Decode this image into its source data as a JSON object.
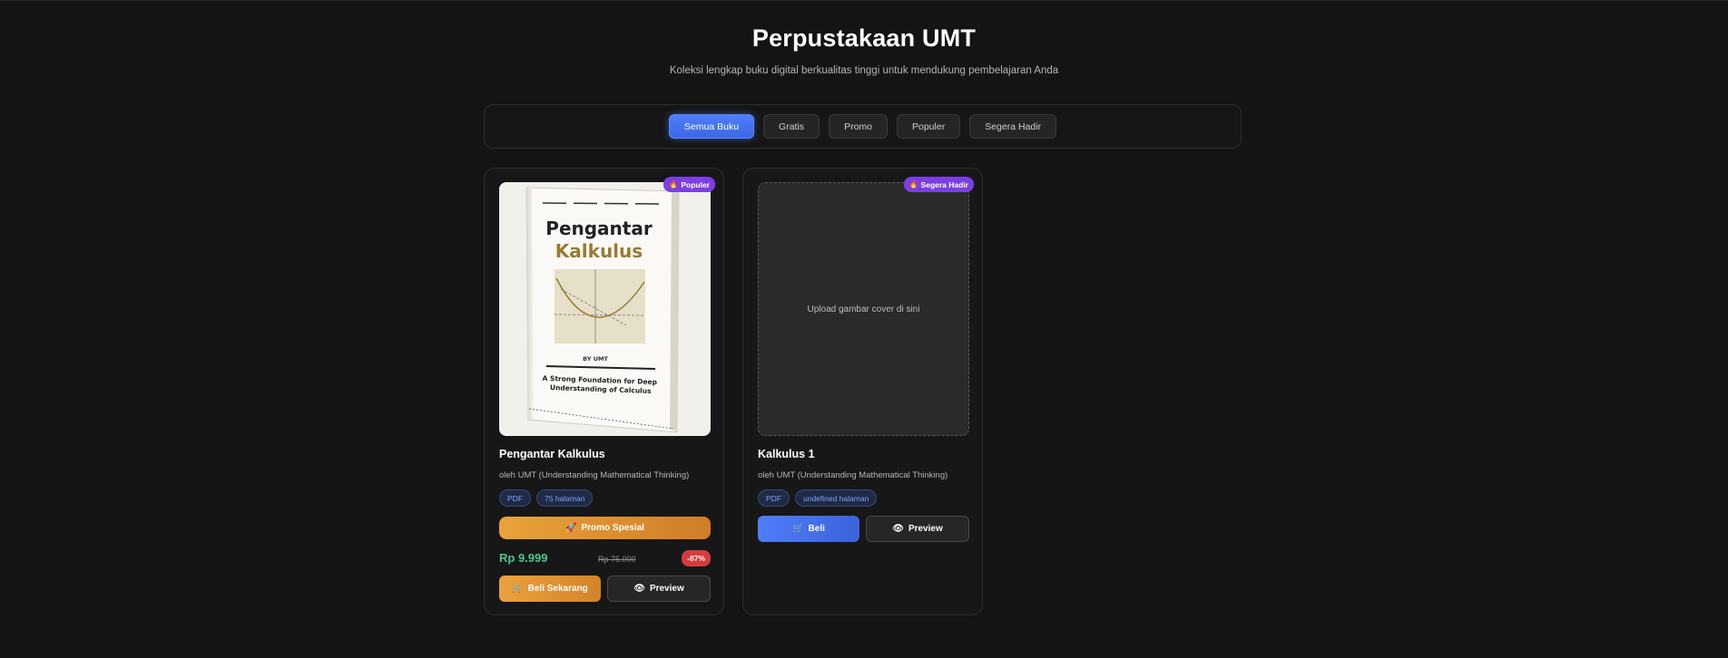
{
  "header": {
    "title": "Perpustakaan UMT",
    "subtitle": "Koleksi lengkap buku digital berkualitas tinggi untuk mendukung pembelajaran Anda"
  },
  "filters": {
    "items": [
      "Semua Buku",
      "Gratis",
      "Promo",
      "Populer",
      "Segera Hadir"
    ],
    "active": "Semua Buku"
  },
  "books": [
    {
      "badge": "Populer",
      "title": "Pengantar Kalkulus",
      "author": "oleh UMT (Understanding Mathematical Thinking)",
      "tags": [
        "PDF",
        "75 halaman"
      ],
      "promo_label": "Promo Spesial",
      "price": "Rp 9.999",
      "old_price": "Rp 75.000",
      "discount": "-87%",
      "buy_label": "Beli Sekarang",
      "preview_label": "Preview",
      "cover": {
        "title_line1": "Pengantar",
        "title_line2": "Kalkulus",
        "by": "BY UMT",
        "tagline": "A Strong Foundation for Deep Understanding of Calculus"
      }
    },
    {
      "badge": "Segera Hadir",
      "title": "Kalkulus 1",
      "author": "oleh UMT (Understanding Mathematical Thinking)",
      "tags": [
        "PDF",
        "undefined halaman"
      ],
      "placeholder": "Upload gambar cover di sini",
      "buy_label": "Beli",
      "preview_label": "Preview"
    }
  ],
  "colors": {
    "accent_blue": "#4f7ef8",
    "accent_orange": "#e8a33a",
    "badge_purple": "#7b3fe4",
    "price_green": "#4cc68a",
    "discount_red": "#d63c3c"
  },
  "icons": {
    "badge": "fire-icon",
    "promo": "rocket-icon",
    "buy": "cart-icon",
    "preview": "eye-icon"
  }
}
